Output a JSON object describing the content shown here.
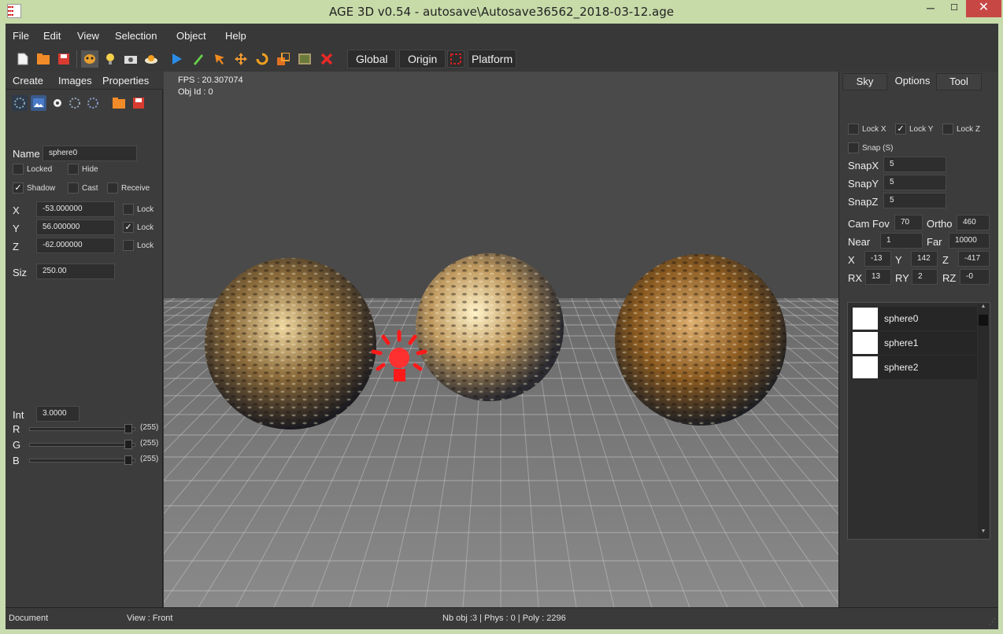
{
  "window": {
    "title": "AGE 3D v0.54 - autosave\\Autosave36562_2018-03-12.age",
    "minimize": "─",
    "maximize": "☐",
    "close": "✕"
  },
  "menu": [
    "File",
    "Edit",
    "View",
    "Selection",
    "Object",
    "Help"
  ],
  "toolbar": {
    "icons": [
      "new-file",
      "open-folder",
      "save",
      "character",
      "light",
      "camera",
      "cloud",
      "play",
      "pencil",
      "select-arrow",
      "move",
      "rotate",
      "scale",
      "texture",
      "delete"
    ],
    "global": "Global",
    "origin": "Origin",
    "platform": "Platform"
  },
  "left_panel": {
    "tabs": [
      "Create",
      "Images",
      "Properties"
    ],
    "name_label": "Name",
    "name_value": "sphere0",
    "locked": "Locked",
    "hide": "Hide",
    "shadow": "Shadow",
    "cast": "Cast",
    "receive": "Receive",
    "x_label": "X",
    "x_value": "-53.000000",
    "y_label": "Y",
    "y_value": "56.000000",
    "z_label": "Z",
    "z_value": "-62.000000",
    "lock": "Lock",
    "size_label": "Siz",
    "size_value": "250.00",
    "int_label": "Int",
    "int_value": "3.0000",
    "r_label": "R",
    "g_label": "G",
    "b_label": "B",
    "r_value": "(255)",
    "g_value": "(255)",
    "b_value": "(255)",
    "checked": {
      "shadow": true,
      "y_lock": true,
      "locked": false,
      "hide": false,
      "cast": false,
      "receive": false,
      "x_lock": false,
      "z_lock": false
    }
  },
  "viewport": {
    "fps": "FPS : 20.307074",
    "obj_id": "Obj Id : 0"
  },
  "right_panel": {
    "tabs": [
      "Sky",
      "Options",
      "Tool"
    ],
    "active_tab": "Options",
    "lock_x": "Lock X",
    "lock_y": "Lock Y",
    "lock_z": "Lock Z",
    "snap": "Snap (S)",
    "snapx_label": "SnapX",
    "snapx": "5",
    "snapy_label": "SnapY",
    "snapy": "5",
    "snapz_label": "SnapZ",
    "snapz": "5",
    "cam_fov_label": "Cam Fov",
    "cam_fov": "70",
    "ortho_label": "Ortho",
    "ortho": "460",
    "near_label": "Near",
    "near": "1",
    "far_label": "Far",
    "far": "10000",
    "x_label": "X",
    "x": "-13",
    "y_label": "Y",
    "y": "142",
    "z_label": "Z",
    "z": "-417",
    "rx_label": "RX",
    "rx": "13",
    "ry_label": "RY",
    "ry": "2",
    "rz_label": "RZ",
    "rz": "-0",
    "objects": [
      "sphere0",
      "sphere1",
      "sphere2"
    ]
  },
  "status": {
    "mode": "Document",
    "view": "View : Front",
    "stats": "Nb obj :3 | Phys : 0 | Poly : 2296"
  }
}
